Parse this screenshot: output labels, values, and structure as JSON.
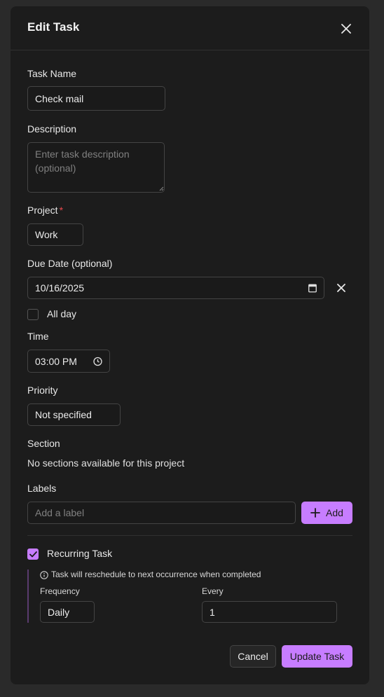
{
  "modal": {
    "title": "Edit Task",
    "close_icon": "close-icon"
  },
  "task_name": {
    "label": "Task Name",
    "value": "Check mail"
  },
  "description": {
    "label": "Description",
    "placeholder": "Enter task description (optional)",
    "value": ""
  },
  "project": {
    "label": "Project",
    "required_marker": "*",
    "value": "Work"
  },
  "due_date": {
    "label": "Due Date (optional)",
    "value": "10/16/2025",
    "calendar_icon": "calendar-icon",
    "clear_icon": "close-icon"
  },
  "all_day": {
    "label": "All day",
    "checked": false
  },
  "time": {
    "label": "Time",
    "value": "03:00 PM",
    "clock_icon": "clock-icon"
  },
  "priority": {
    "label": "Priority",
    "value": "Not specified"
  },
  "section": {
    "label": "Section",
    "message": "No sections available for this project"
  },
  "labels": {
    "label": "Labels",
    "placeholder": "Add a label",
    "add_button": "Add",
    "add_icon": "plus-icon"
  },
  "recurring": {
    "label": "Recurring Task",
    "checked": true,
    "info_icon": "info-icon",
    "info_text": "Task will reschedule to next occurrence when completed",
    "frequency_label": "Frequency",
    "frequency_value": "Daily",
    "every_label": "Every",
    "every_value": "1"
  },
  "footer": {
    "cancel_label": "Cancel",
    "update_label": "Update Task"
  },
  "colors": {
    "accent": "#c77dff",
    "background": "#1c1c1c",
    "required": "#e5484d"
  }
}
